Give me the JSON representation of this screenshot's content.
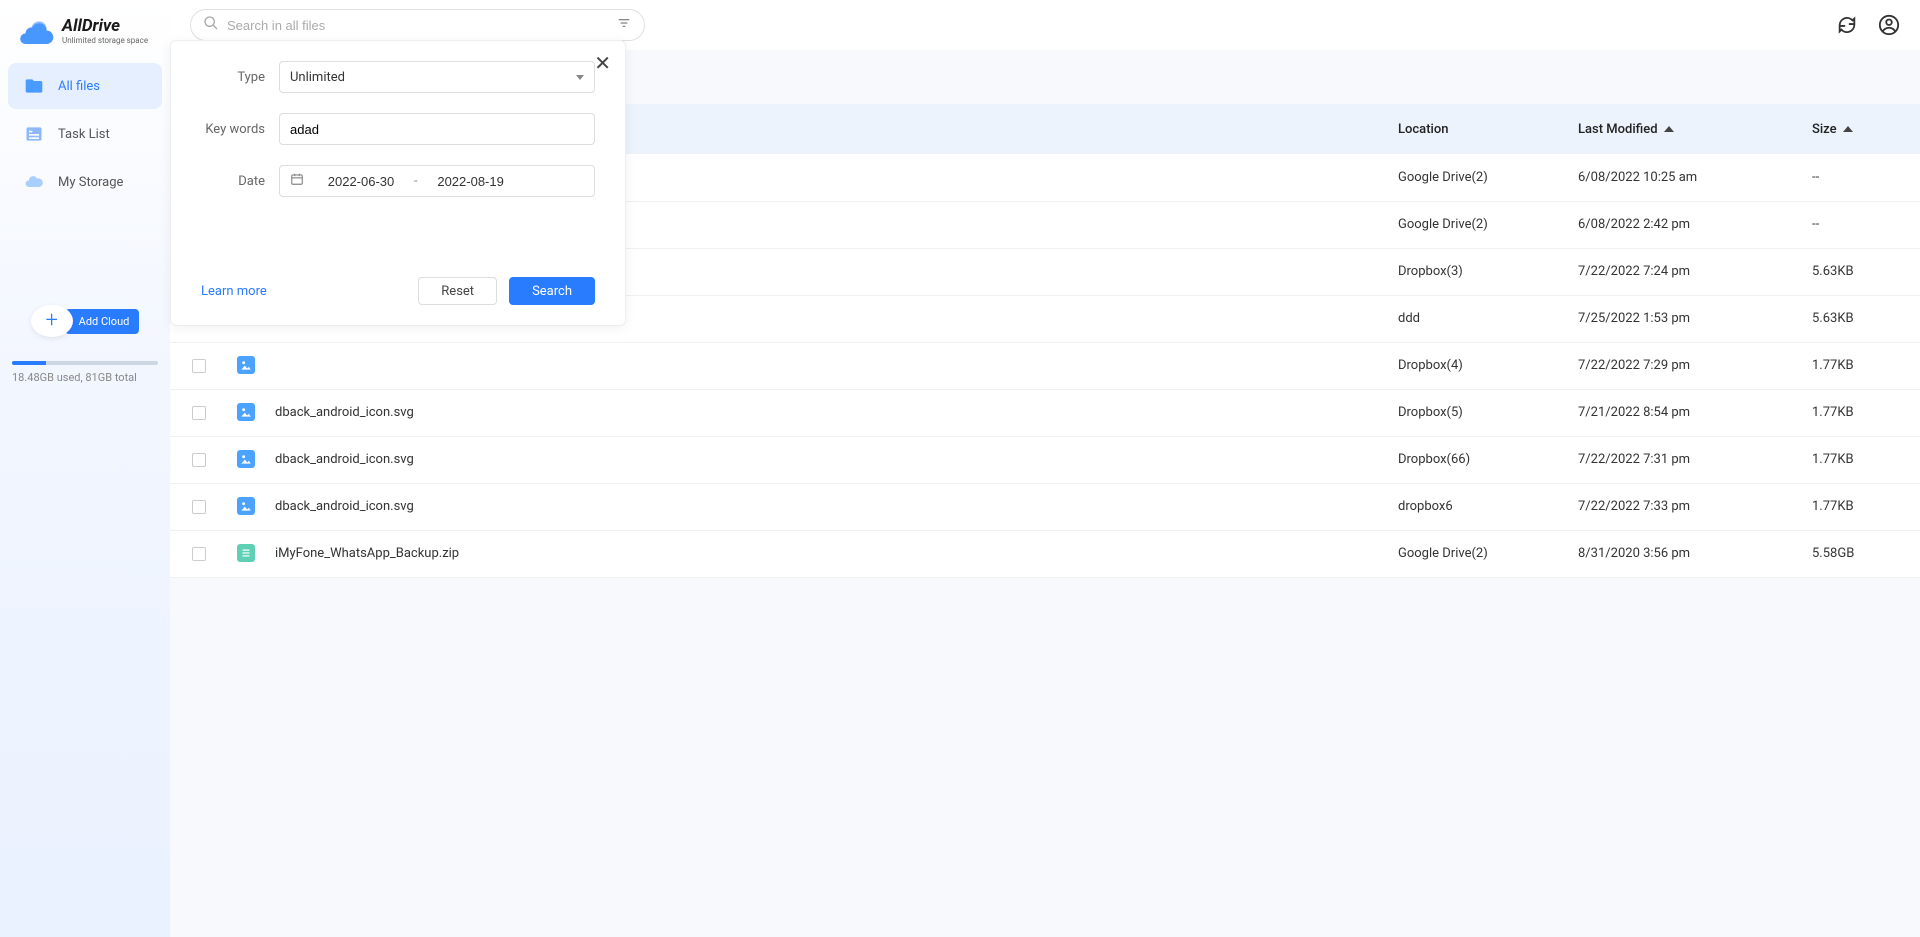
{
  "app": {
    "name": "AllDrive",
    "tagline": "Unlimited storage space"
  },
  "search": {
    "placeholder": "Search in all files"
  },
  "sidebar": {
    "items": [
      {
        "label": "All files",
        "active": true
      },
      {
        "label": "Task List",
        "active": false
      },
      {
        "label": "My Storage",
        "active": false
      }
    ],
    "addCloud": "Add Cloud",
    "storageText": "18.48GB used, 81GB total"
  },
  "panel": {
    "typeLabel": "Type",
    "typeValue": "Unlimited",
    "keywordsLabel": "Key words",
    "keywordsValue": "adad",
    "dateLabel": "Date",
    "dateFrom": "2022-06-30",
    "dateTo": "2022-08-19",
    "learnMore": "Learn more",
    "reset": "Reset",
    "search": "Search"
  },
  "table": {
    "headers": {
      "location": "Location",
      "modified": "Last Modified",
      "size": "Size"
    },
    "rows": [
      {
        "name": "",
        "icon": "",
        "location": "Google Drive(2)",
        "modified": "6/08/2022 10:25 am",
        "size": "--"
      },
      {
        "name": "",
        "icon": "",
        "location": "Google Drive(2)",
        "modified": "6/08/2022 2:42 pm",
        "size": "--"
      },
      {
        "name": "",
        "icon": "",
        "location": "Dropbox(3)",
        "modified": "7/22/2022 7:24 pm",
        "size": "5.63KB"
      },
      {
        "name": "",
        "icon": "",
        "location": "ddd",
        "modified": "7/25/2022 1:53 pm",
        "size": "5.63KB"
      },
      {
        "name": "",
        "icon": "image",
        "location": "Dropbox(4)",
        "modified": "7/22/2022 7:29 pm",
        "size": "1.77KB"
      },
      {
        "name": "dback_android_icon.svg",
        "icon": "image",
        "location": "Dropbox(5)",
        "modified": "7/21/2022 8:54 pm",
        "size": "1.77KB"
      },
      {
        "name": "dback_android_icon.svg",
        "icon": "image",
        "location": "Dropbox(66)",
        "modified": "7/22/2022 7:31 pm",
        "size": "1.77KB"
      },
      {
        "name": "dback_android_icon.svg",
        "icon": "image",
        "location": "dropbox6",
        "modified": "7/22/2022 7:33 pm",
        "size": "1.77KB"
      },
      {
        "name": "iMyFone_WhatsApp_Backup.zip",
        "icon": "zip",
        "location": "Google Drive(2)",
        "modified": "8/31/2020 3:56 pm",
        "size": "5.58GB"
      }
    ]
  }
}
